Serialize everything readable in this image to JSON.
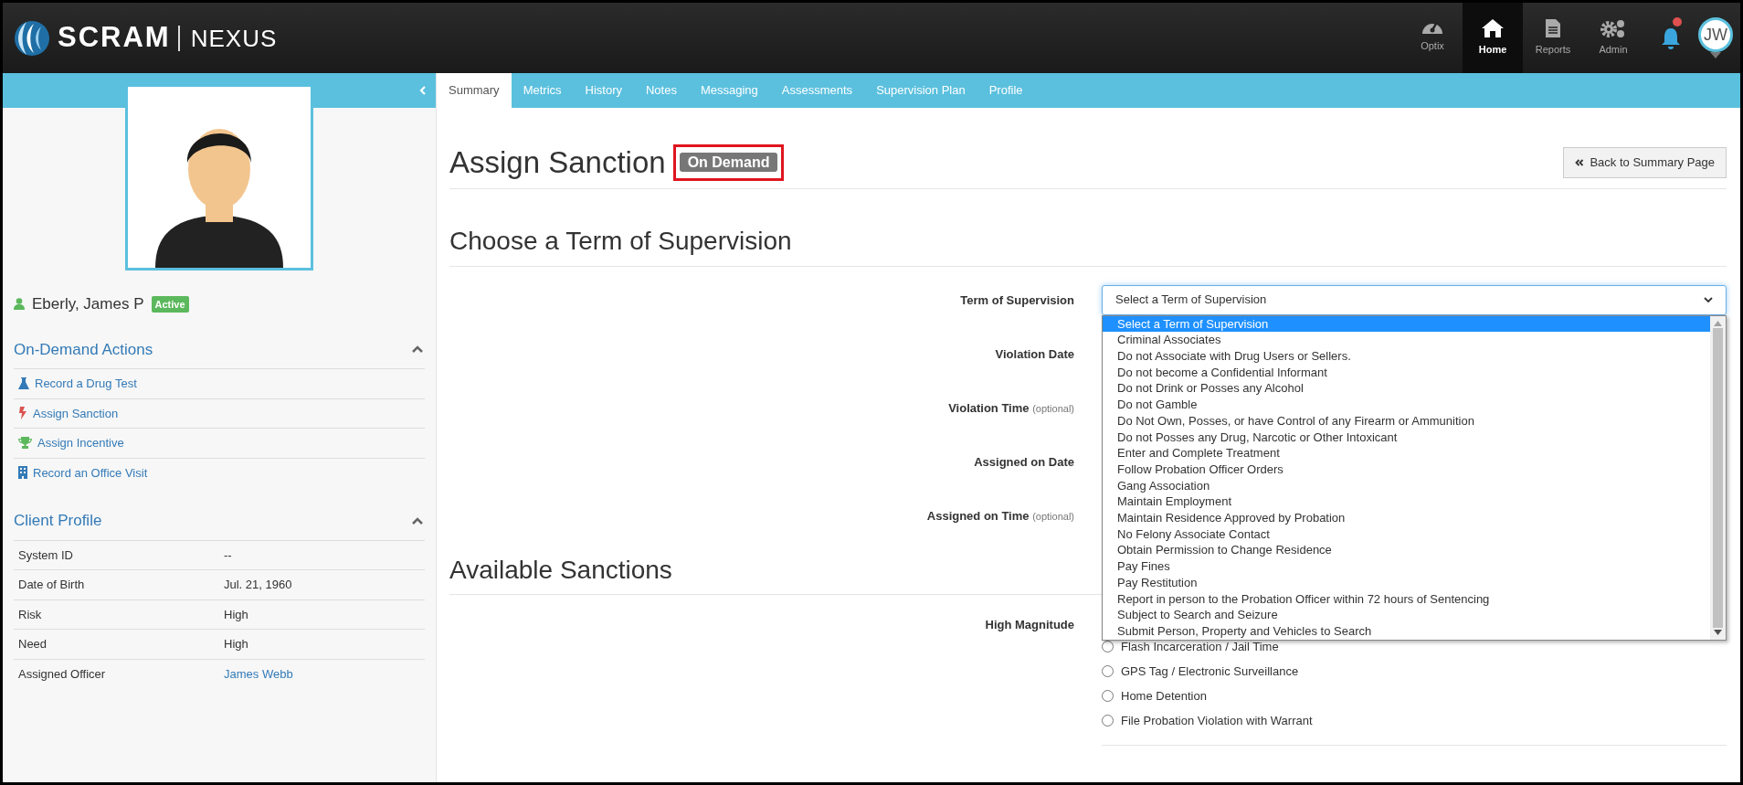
{
  "header": {
    "logo_text": "SCRAM",
    "logo_subtext": "NEXUS",
    "nav": [
      {
        "label": "Optix",
        "selected": false
      },
      {
        "label": "Home",
        "selected": true
      },
      {
        "label": "Reports",
        "selected": false
      },
      {
        "label": "Admin",
        "selected": false
      }
    ],
    "notifications": {
      "unread": true
    },
    "user_initials": "JW"
  },
  "sidebar": {
    "client": {
      "name": "Eberly, James P",
      "status": "Active"
    },
    "actions_section": {
      "title": "On-Demand Actions",
      "expanded": true,
      "items": [
        {
          "label": "Record a Drug Test"
        },
        {
          "label": "Assign Sanction"
        },
        {
          "label": "Assign Incentive"
        },
        {
          "label": "Record an Office Visit"
        }
      ]
    },
    "profile_section": {
      "title": "Client Profile",
      "expanded": true,
      "rows": [
        {
          "label": "System ID",
          "value": "--",
          "kind": "text"
        },
        {
          "label": "Date of Birth",
          "value": "Jul. 21, 1960",
          "kind": "text"
        },
        {
          "label": "Risk",
          "value": "High",
          "kind": "text"
        },
        {
          "label": "Need",
          "value": "High",
          "kind": "text"
        },
        {
          "label": "Assigned Officer",
          "value": "James Webb",
          "kind": "link"
        }
      ]
    }
  },
  "tabs": [
    {
      "label": "Summary",
      "selected": true
    },
    {
      "label": "Metrics",
      "selected": false
    },
    {
      "label": "History",
      "selected": false
    },
    {
      "label": "Notes",
      "selected": false
    },
    {
      "label": "Messaging",
      "selected": false
    },
    {
      "label": "Assessments",
      "selected": false
    },
    {
      "label": "Supervision Plan",
      "selected": false
    },
    {
      "label": "Profile",
      "selected": false
    }
  ],
  "page": {
    "title": "Assign Sanction",
    "badge": {
      "label": "On Demand",
      "highlighted": true
    },
    "back_button": "Back to Summary Page",
    "term_section": {
      "heading": "Choose a Term of Supervision",
      "fields": [
        {
          "label": "Term of Supervision"
        },
        {
          "label": "Violation Date"
        },
        {
          "label": "Violation Time",
          "hint": "(optional)"
        },
        {
          "label": "Assigned on Date"
        },
        {
          "label": "Assigned on Time",
          "hint": "(optional)"
        }
      ],
      "term_select": {
        "value": "Select a Term of Supervision",
        "expanded": true,
        "options": [
          {
            "label": "Select a Term of Supervision",
            "selected": true
          },
          {
            "label": "Criminal Associates",
            "selected": false
          },
          {
            "label": "Do not Associate with Drug Users or Sellers.",
            "selected": false
          },
          {
            "label": "Do not become a Confidential Informant",
            "selected": false
          },
          {
            "label": "Do not Drink or Posses any Alcohol",
            "selected": false
          },
          {
            "label": "Do not Gamble",
            "selected": false
          },
          {
            "label": "Do Not Own, Posses, or have Control of any Firearm or Ammunition",
            "selected": false
          },
          {
            "label": "Do not Posses any Drug, Narcotic or Other Intoxicant",
            "selected": false
          },
          {
            "label": "Enter and Complete Treatment",
            "selected": false
          },
          {
            "label": "Follow Probation Officer Orders",
            "selected": false
          },
          {
            "label": "Gang Association",
            "selected": false
          },
          {
            "label": "Maintain Employment",
            "selected": false
          },
          {
            "label": "Maintain Residence Approved by Probation",
            "selected": false
          },
          {
            "label": "No Felony Associate Contact",
            "selected": false
          },
          {
            "label": "Obtain Permission to Change Residence",
            "selected": false
          },
          {
            "label": "Pay Fines",
            "selected": false
          },
          {
            "label": "Pay Restitution",
            "selected": false
          },
          {
            "label": "Report in person to the Probation Officer within 72 hours of Sentencing",
            "selected": false
          },
          {
            "label": "Subject to Search and Seizure",
            "selected": false
          },
          {
            "label": "Submit Person, Property and Vehicles to Search",
            "selected": false
          }
        ]
      }
    },
    "sanctions_section": {
      "heading": "Available Sanctions",
      "groups": [
        {
          "label": "High Magnitude",
          "options": [
            {
              "label": "Flash Incarceration / Jail Time",
              "checked": false
            },
            {
              "label": "GPS Tag / Electronic Surveillance",
              "checked": false
            },
            {
              "label": "Home Detention",
              "checked": false
            },
            {
              "label": "File Probation Violation with Warrant",
              "checked": false
            }
          ]
        }
      ]
    }
  }
}
